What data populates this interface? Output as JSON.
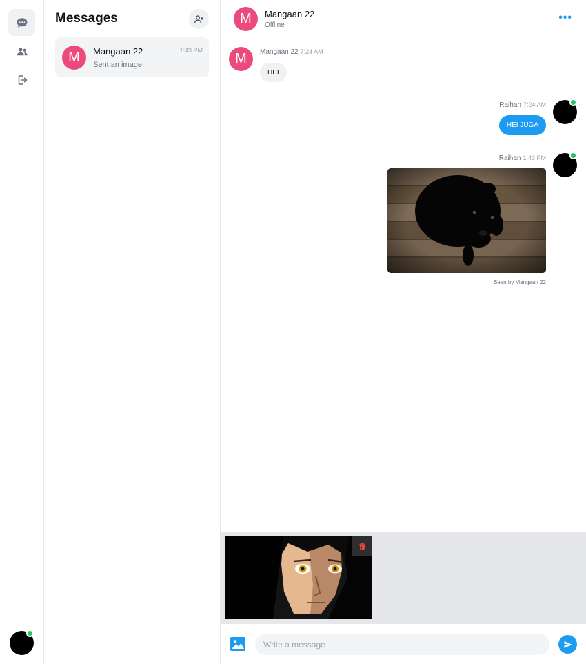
{
  "colors": {
    "accent": "#1d9bf0",
    "contact_avatar": "#ec4a7d",
    "online": "#22c55e",
    "delete": "#ef4444"
  },
  "rail": {
    "items": [
      {
        "icon": "chat-bubble-icon",
        "active": true
      },
      {
        "icon": "users-icon",
        "active": false
      },
      {
        "icon": "logout-icon",
        "active": false
      }
    ],
    "user_online": true
  },
  "sidebar": {
    "title": "Messages",
    "add_icon": "add-user-icon",
    "conversations": [
      {
        "initial": "M",
        "name": "Mangaan 22",
        "time": "1:43 PM",
        "preview": "Sent an image"
      }
    ]
  },
  "chat": {
    "header": {
      "initial": "M",
      "name": "Mangaan 22",
      "status": "Offline",
      "more_icon": "ellipsis-icon"
    },
    "messages": [
      {
        "direction": "incoming",
        "sender": "Mangaan 22",
        "time": "7:24 AM",
        "text": "HEI"
      },
      {
        "direction": "outgoing",
        "sender": "Raihan",
        "time": "7:24 AM",
        "text": "HEI JUGA"
      },
      {
        "direction": "outgoing",
        "sender": "Raihan",
        "time": "1:43 PM",
        "image": "black-puppy-photo",
        "seen": "Seen by Mangaan 22"
      }
    ]
  },
  "attachment": {
    "image": "anime-portrait-image",
    "delete_icon": "trash-icon"
  },
  "composer": {
    "placeholder": "Write a message",
    "value": "",
    "image_icon": "image-icon",
    "send_icon": "send-icon"
  }
}
